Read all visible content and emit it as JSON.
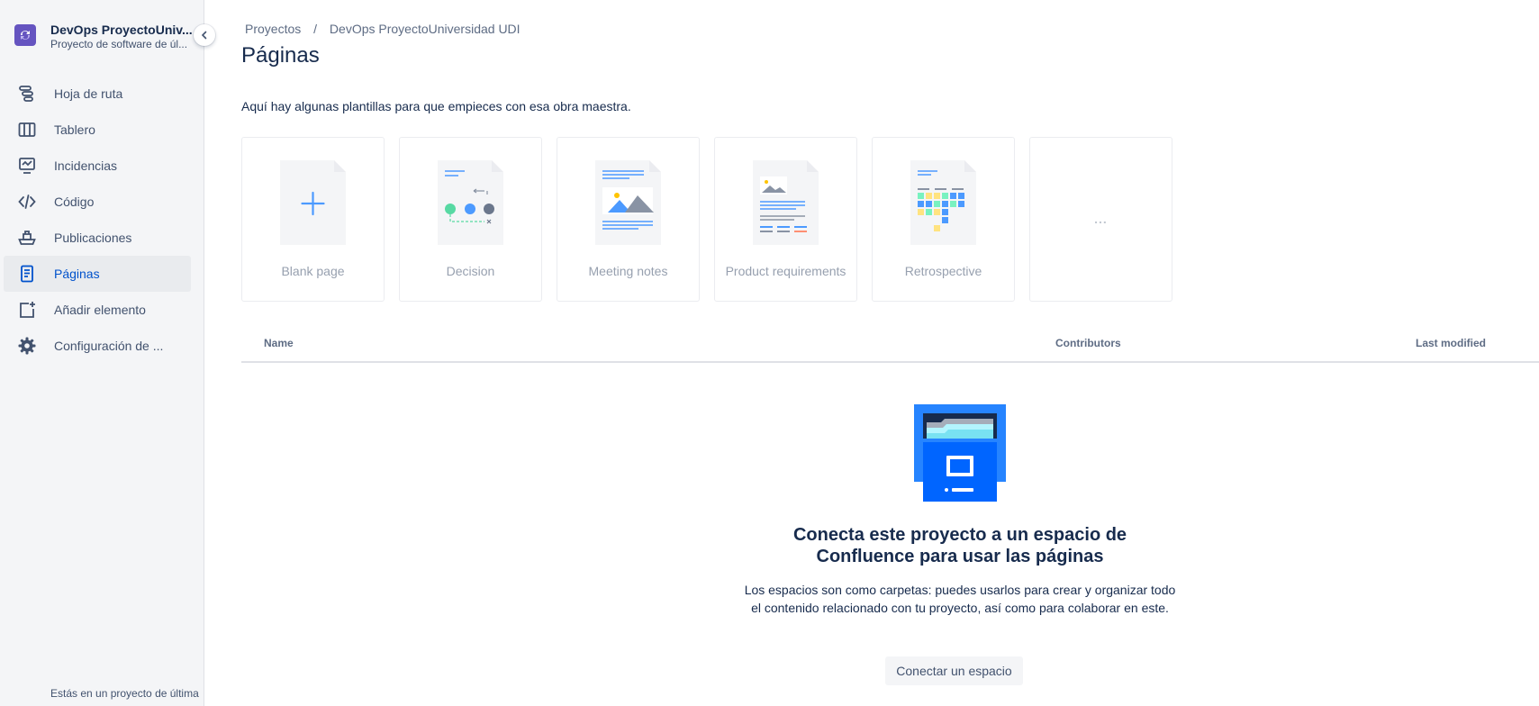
{
  "sidebar": {
    "project_name": "DevOps ProyectoUniv...",
    "project_type": "Proyecto de software de úl...",
    "items": [
      {
        "label": "Hoja de ruta",
        "icon": "roadmap-icon"
      },
      {
        "label": "Tablero",
        "icon": "board-icon"
      },
      {
        "label": "Incidencias",
        "icon": "issues-icon"
      },
      {
        "label": "Código",
        "icon": "code-icon"
      },
      {
        "label": "Publicaciones",
        "icon": "releases-icon"
      },
      {
        "label": "Páginas",
        "icon": "pages-icon",
        "active": true
      },
      {
        "label": "Añadir elemento",
        "icon": "add-item-icon"
      },
      {
        "label": "Configuración de ...",
        "icon": "settings-icon"
      }
    ],
    "footer": "Estás en un proyecto de última"
  },
  "breadcrumb": {
    "root": "Proyectos",
    "separator": "/",
    "current": "DevOps ProyectoUniversidad UDI"
  },
  "page_title": "Páginas",
  "intro": "Aquí hay algunas plantillas para que empieces con esa obra maestra.",
  "templates": [
    {
      "label": "Blank page"
    },
    {
      "label": "Decision"
    },
    {
      "label": "Meeting notes"
    },
    {
      "label": "Product requirements"
    },
    {
      "label": "Retrospective"
    },
    {
      "label": "..."
    }
  ],
  "table": {
    "col_name": "Name",
    "col_contributors": "Contributors",
    "col_modified": "Last modified"
  },
  "empty_state": {
    "title": "Conecta este proyecto a un espacio de Confluence para usar las páginas",
    "description": "Los espacios son como carpetas: puedes usarlos para crear y organizar todo el contenido relacionado con tu proyecto, así como para colaborar en este.",
    "button": "Conectar un espacio"
  },
  "colors": {
    "accent": "#0052cc",
    "avatar": "#6554c0",
    "sidebar_bg": "#f4f5f7"
  }
}
